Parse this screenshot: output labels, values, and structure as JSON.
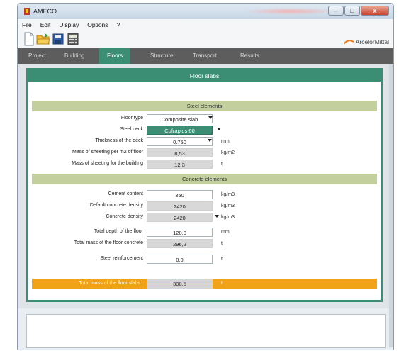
{
  "window": {
    "title": "AMECO",
    "controls": {
      "minimize": "–",
      "maximize": "□",
      "close": "x"
    }
  },
  "menu": {
    "items": [
      "File",
      "Edit",
      "Display",
      "Options",
      "?"
    ]
  },
  "toolbar": {
    "icons": [
      "new-document-icon",
      "open-folder-icon",
      "save-icon",
      "calculator-icon"
    ],
    "logo_text": "ArcelorMittal"
  },
  "tabs": {
    "items": [
      "Project",
      "Building",
      "Floors",
      "Structure",
      "Transport",
      "Results"
    ],
    "active": "Floors"
  },
  "panel": {
    "title": "Floor slabs",
    "steel": {
      "header": "Steel elements",
      "floor_type": {
        "label": "Floor type",
        "value": "Composite slab"
      },
      "steel_deck": {
        "label": "Steel deck",
        "value": "Cofraplus 60"
      },
      "thickness": {
        "label": "Thickness of the deck",
        "value": "0.750",
        "unit": "mm"
      },
      "mass_m2": {
        "label": "Mass of sheeting per m2 of floor",
        "value": "8,53",
        "unit": "kg/m2"
      },
      "mass_building": {
        "label": "Mass of sheeting for the building",
        "value": "12,3",
        "unit": "t"
      }
    },
    "concrete": {
      "header": "Concrete elements",
      "cement_content": {
        "label": "Cement content",
        "value": "350",
        "unit": "kg/m3"
      },
      "default_density": {
        "label": "Default concrete density",
        "value": "2420",
        "unit": "kg/m3"
      },
      "concrete_density": {
        "label": "Concrete density",
        "value": "2420",
        "unit": "kg/m3"
      },
      "total_depth": {
        "label": "Total depth of the floor",
        "value": "120,0",
        "unit": "mm"
      },
      "total_mass_concrete": {
        "label": "Total mass of the floor concrete",
        "value": "296,2",
        "unit": "t"
      },
      "steel_reinforcement": {
        "label": "Steel reinforcement",
        "value": "0,0",
        "unit": "t"
      }
    },
    "total": {
      "label": "Total mass of the floor slabs",
      "value": "308,5",
      "unit": "t"
    }
  },
  "colors": {
    "accent": "#3b8e74",
    "section": "#c3cf9d",
    "total": "#f0a316",
    "tabbar": "#5d5d5d"
  }
}
